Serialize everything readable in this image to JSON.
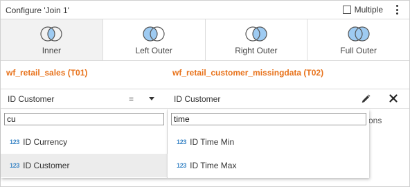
{
  "header": {
    "title": "Configure 'Join 1'",
    "multiple_label": "Multiple",
    "multiple_checked": false
  },
  "join_types": [
    {
      "label": "Inner",
      "selected": true,
      "icon": "inner-join-venn-icon"
    },
    {
      "label": "Left Outer",
      "selected": false,
      "icon": "left-outer-join-venn-icon"
    },
    {
      "label": "Right Outer",
      "selected": false,
      "icon": "right-outer-join-venn-icon"
    },
    {
      "label": "Full Outer",
      "selected": false,
      "icon": "full-outer-join-venn-icon"
    }
  ],
  "tables": {
    "left": "wf_retail_sales (T01)",
    "right": "wf_retail_customer_missingdata (T02)"
  },
  "condition": {
    "left_field": "ID Customer",
    "operator": "=",
    "right_field": "ID Customer"
  },
  "behind_text": "ons",
  "left_dropdown": {
    "search_value": "cu",
    "options": [
      {
        "icon": "123",
        "label": "ID Currency",
        "highlighted": false
      },
      {
        "icon": "123",
        "label": "ID Customer",
        "highlighted": true
      }
    ]
  },
  "right_dropdown": {
    "search_value": "time",
    "options": [
      {
        "icon": "123",
        "label": "ID Time Min",
        "highlighted": false
      },
      {
        "icon": "123",
        "label": "ID Time Max",
        "highlighted": false
      }
    ]
  },
  "colors": {
    "table_name": "#e8731c",
    "venn_fill": "#9ecbf2",
    "venn_stroke": "#555555",
    "numeric_icon": "#3b86c6",
    "selected_bg": "#f2f2f2"
  }
}
